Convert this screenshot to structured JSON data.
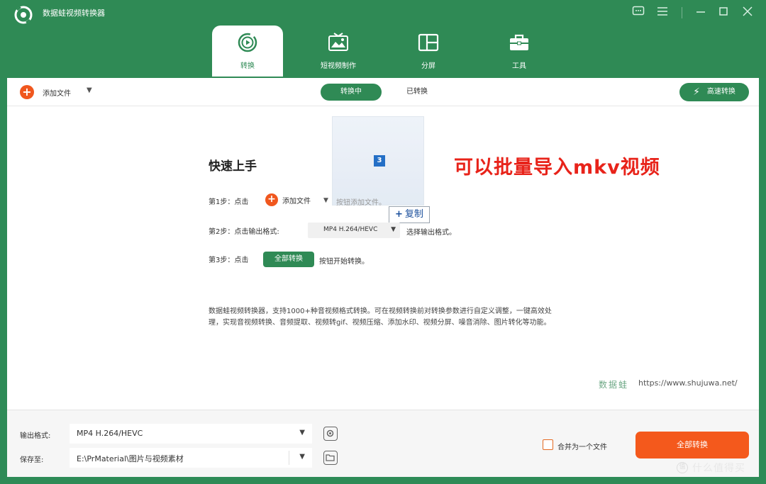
{
  "app": {
    "title": "数据蛙视频转换器"
  },
  "tabs": [
    {
      "label": "转换",
      "icon": "convert-icon",
      "active": true
    },
    {
      "label": "短视频制作",
      "icon": "tv-icon",
      "active": false
    },
    {
      "label": "分屏",
      "icon": "split-screen-icon",
      "active": false
    },
    {
      "label": "工具",
      "icon": "toolbox-icon",
      "active": false
    }
  ],
  "toolbar": {
    "add_file": "添加文件",
    "converting": "转换中",
    "converted": "已转换",
    "fast_convert": "高速转换"
  },
  "quick_start": {
    "title": "快速上手",
    "step1_prefix": "第1步：点击",
    "step1_button": "添加文件",
    "step1_suffix": "按钮添加文件。",
    "step2_prefix": "第2步：点击输出格式:",
    "step2_select": "MP4 H.264/HEVC",
    "step2_suffix": "选择输出格式。",
    "step3_prefix": "第3步：点击",
    "step3_button": "全部转换",
    "step3_suffix": "按钮开始转换。",
    "description": "数据蛙视频转换器，支持1000+种音视频格式转换。可在视频转换前对转换参数进行自定义调整，一键高效处理，实现音视频转换、音频提取、视频转gif、视频压缩、添加水印、视频分屏、噪音消除、图片转化等功能。"
  },
  "drag": {
    "count": "3",
    "copy_tooltip": "复制"
  },
  "annotation": "可以批量导入mkv视频",
  "brand": {
    "mark": "数据蛙",
    "url": "https://www.shujuwa.net/"
  },
  "bottom": {
    "output_label": "输出格式:",
    "output_value": "MP4 H.264/HEVC",
    "save_label": "保存至:",
    "save_value": "E:\\PrMaterial\\图片与视频素材",
    "merge_label": "合并为一个文件",
    "convert_all": "全部转换"
  },
  "watermark": {
    "logo": "值",
    "text": "什么值得买"
  },
  "colors": {
    "brand_green": "#2f8a55",
    "accent_orange": "#f4591c",
    "annotation_red": "#e8231a"
  }
}
